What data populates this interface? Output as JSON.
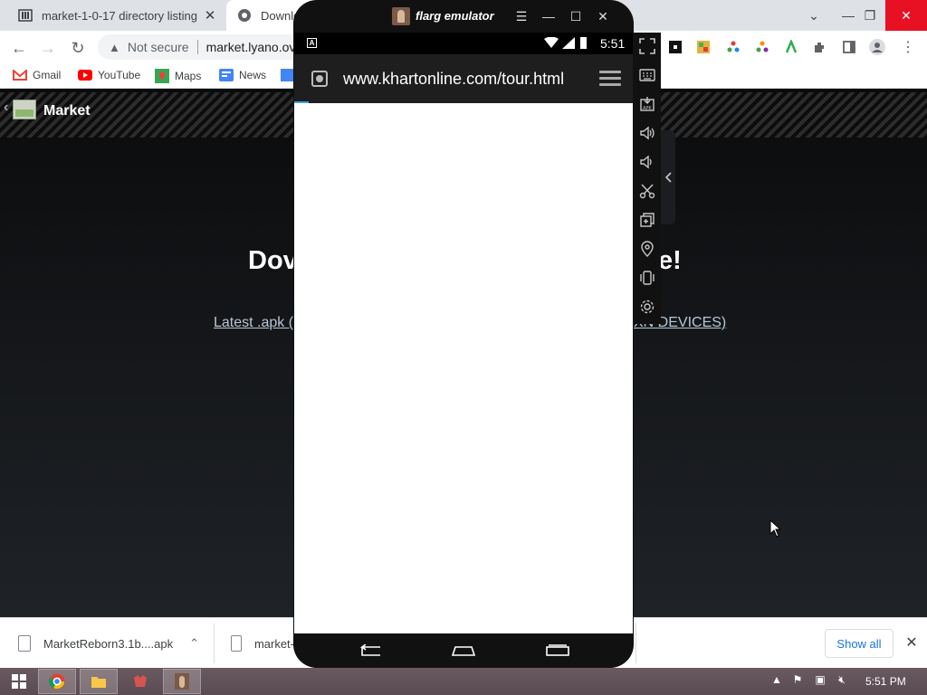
{
  "browser": {
    "tabs": [
      {
        "title": "market-1-0-17 directory listing",
        "icon": "archive-icon"
      },
      {
        "title": "Downloa",
        "icon": "globe-icon"
      }
    ],
    "address": {
      "security_label": "Not secure",
      "url": "market.lyano.ov"
    },
    "bookmarks": [
      {
        "label": "Gmail",
        "icon": "gmail-icon"
      },
      {
        "label": "YouTube",
        "icon": "youtube-icon"
      },
      {
        "label": "Maps",
        "icon": "maps-icon"
      },
      {
        "label": "News",
        "icon": "news-icon"
      }
    ]
  },
  "webpage": {
    "site_name": "Market",
    "heading_left": "Dov",
    "heading_right": "e!",
    "link_left": "Latest .apk (",
    "link_right": "XN DEVICES)"
  },
  "emulator": {
    "title": "flarg emulator",
    "status_time": "5:51",
    "browser_url": "www.khartonline.com/tour.html",
    "sidebar_tools": [
      "fullscreen-icon",
      "keyboard-icon",
      "install-apk-icon",
      "volume-up-icon",
      "volume-down-icon",
      "screenshot-icon",
      "multi-instance-icon",
      "location-icon",
      "shake-icon",
      "settings-icon"
    ]
  },
  "downloads": {
    "items": [
      {
        "name": "MarketReborn3.1b....apk"
      },
      {
        "name": "market-"
      }
    ],
    "show_all": "Show all"
  },
  "taskbar": {
    "apps": [
      "start-icon",
      "chrome-icon",
      "file-explorer-icon",
      "game-icon",
      "flarg-emulator-icon"
    ],
    "clock": "5:51 PM"
  },
  "colors": {
    "chrome_tabstrip": "#dee1e6",
    "link_blue": "#1a73e8",
    "emulator_frame": "#111111",
    "progress_accent": "#3aa3d8",
    "taskbar": "#5e4e56"
  }
}
